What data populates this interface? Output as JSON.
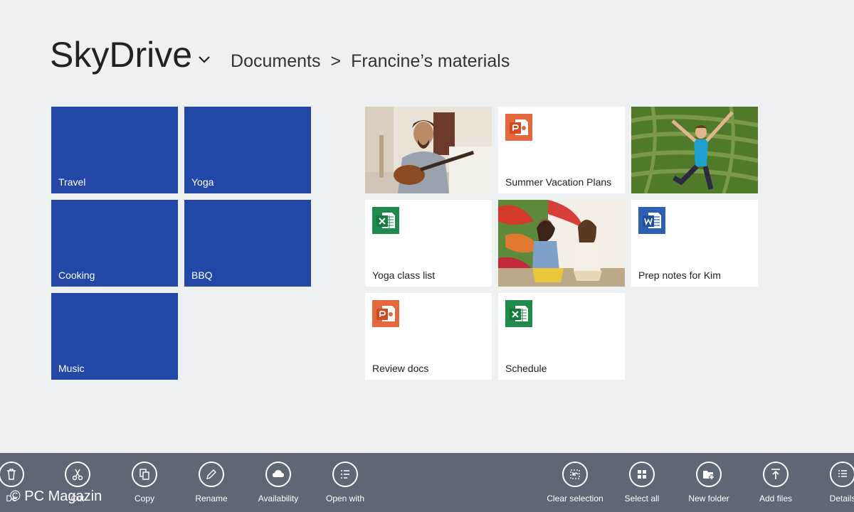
{
  "header": {
    "app_title": "SkyDrive",
    "breadcrumb": [
      "Documents",
      "Francine’s materials"
    ],
    "separator": ">"
  },
  "folders": [
    {
      "label": "Travel"
    },
    {
      "label": "Yoga"
    },
    {
      "label": "Cooking"
    },
    {
      "label": "BBQ"
    },
    {
      "label": "Music"
    }
  ],
  "files": [
    {
      "label": "",
      "kind": "photo-guitar"
    },
    {
      "label": "Summer Vacation Plans",
      "kind": "powerpoint-icon"
    },
    {
      "label": "",
      "kind": "photo-maze"
    },
    {
      "label": "Yoga class list",
      "kind": "excel-icon"
    },
    {
      "label": "",
      "kind": "photo-friends"
    },
    {
      "label": "Prep notes for Kim",
      "kind": "word-icon"
    },
    {
      "label": "Review docs",
      "kind": "powerpoint-icon"
    },
    {
      "label": "Schedule",
      "kind": "excel-icon"
    }
  ],
  "appbar": {
    "left": [
      {
        "label": "De",
        "icon": "trash-icon"
      },
      {
        "label": "Cut",
        "icon": "scissors-icon"
      },
      {
        "label": "Copy",
        "icon": "copy-icon"
      },
      {
        "label": "Rename",
        "icon": "pencil-icon"
      },
      {
        "label": "Availability",
        "icon": "cloud-icon"
      },
      {
        "label": "Open with",
        "icon": "list-icon"
      }
    ],
    "right": [
      {
        "label": "Clear selection",
        "icon": "undo-icon"
      },
      {
        "label": "Select all",
        "icon": "grid-icon"
      },
      {
        "label": "New folder",
        "icon": "folder-plus-icon"
      },
      {
        "label": "Add files",
        "icon": "upload-icon"
      },
      {
        "label": "Details",
        "icon": "details-icon"
      }
    ]
  },
  "watermark": "© PC Magazin",
  "colors": {
    "folder_tile": "#2247a6",
    "app_bar": "#5f6674",
    "background": "#eef1f1",
    "powerpoint": "#e3683e",
    "excel": "#1f8a4c",
    "word": "#2d5fb2"
  }
}
